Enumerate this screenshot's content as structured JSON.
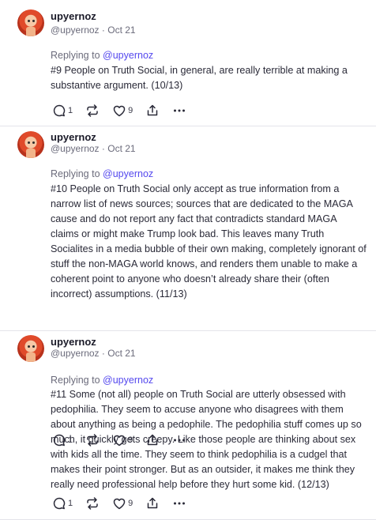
{
  "posts": [
    {
      "username": "upyernoz",
      "handle": "@upyernoz",
      "date": "Oct 21",
      "replying_label": "Replying to",
      "replying_to": "@upyernoz",
      "text": "#9 People on Truth Social, in general, are really terrible at making a substantive argument. (10/13)",
      "replies": "1",
      "likes": "9"
    },
    {
      "username": "upyernoz",
      "handle": "@upyernoz",
      "date": "Oct 21",
      "replying_label": "Replying to",
      "replying_to": "@upyernoz",
      "text": "#10 People on Truth Social only accept as true information from a narrow list of news sources; sources that are dedicated to the MAGA cause and do not report any fact that contradicts standard MAGA claims or might make Trump look bad. This leaves many Truth Socialites in a media bubble of their own making, completely ignorant of stuff the non-MAGA world knows, and renders them unable to make a coherent point to anyone who doesn’t already share their (often incorrect) assumptions. (11/13)",
      "replies": "1",
      "likes": "9"
    },
    {
      "username": "upyernoz",
      "handle": "@upyernoz",
      "date": "Oct 21",
      "replying_label": "Replying to",
      "replying_to": "@upyernoz",
      "text": "#11 Some (not all) people on Truth Social are utterly obsessed with pedophilia. They seem to accuse anyone who disagrees with them about anything as being a pedophile. The pedophilia stuff comes up so much, it quickly gets creepy. Like those people are thinking about sex with kids all the time. They seem to think pedophilia is a cudgel that makes their point stronger. But as an outsider, it makes me think they really need professional help before they hurt some kid. (12/13)",
      "replies": "1",
      "likes": "9"
    }
  ],
  "icons": {
    "reply": "reply-icon",
    "repost": "repost-icon",
    "like": "heart-icon",
    "share": "share-icon",
    "more": "more-icon"
  },
  "colors": {
    "mention": "#5448ee",
    "muted": "#6b6b7b",
    "text": "#2a2a38",
    "divider": "#e4e4ea"
  }
}
